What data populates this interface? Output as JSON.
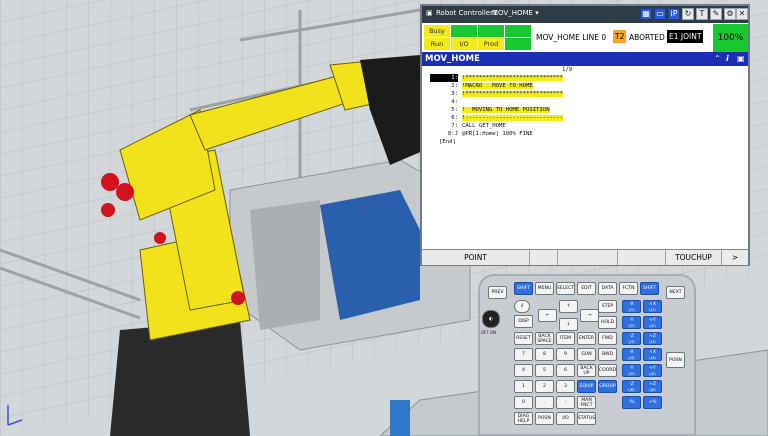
{
  "window": {
    "title": "Robot Controller1",
    "program_dropdown": "MOV_HOME"
  },
  "titlebar_icons": [
    "keyboard-icon",
    "screen-icon",
    "ip-icon",
    "refresh-icon",
    "text-icon",
    "edit-icon",
    "settings-icon",
    "close-icon"
  ],
  "status": {
    "leds": [
      {
        "label": "Busy",
        "color": "#f2ea1a"
      },
      {
        "label": "",
        "color": "#18c82f"
      },
      {
        "label": "",
        "color": "#18c82f"
      },
      {
        "label": "",
        "color": "#18c82f"
      },
      {
        "label": "Run",
        "color": "#f2ea1a"
      },
      {
        "label": "I/O",
        "color": "#f2ea1a"
      },
      {
        "label": "Prod",
        "color": "#f2ea1a"
      },
      {
        "label": "",
        "color": "#18c82f"
      }
    ],
    "line_text": "MOV_HOME LINE 0",
    "t2": "T2",
    "state": "ABORTED",
    "joint": "E1 JOINT",
    "override": "100%"
  },
  "program": {
    "name": "MOV_HOME",
    "position": "1/9",
    "lines": [
      {
        "no": "1:",
        "text": "!*****************************",
        "highlight": true,
        "cursor": true
      },
      {
        "no": "2:",
        "text": "!MACRO   MOVE TO HOME",
        "highlight": true,
        "cursor": false
      },
      {
        "no": "3:",
        "text": "!*****************************",
        "highlight": true,
        "cursor": false
      },
      {
        "no": "4:",
        "text": "",
        "highlight": false,
        "cursor": false
      },
      {
        "no": "5:",
        "text": "!  MOVING TO HOME POSITION",
        "highlight": true,
        "cursor": false
      },
      {
        "no": "6:",
        "text": "!-----------------------------",
        "highlight": true,
        "cursor": false
      },
      {
        "no": "7:",
        "text": "CALL GET_HOME",
        "highlight": false,
        "cursor": false
      },
      {
        "no": "8:J",
        "text": "@PR[1:Home] 100% FINE",
        "highlight": false,
        "cursor": false
      }
    ],
    "end_marker": "[End]"
  },
  "softkeys": [
    "POINT",
    "",
    "",
    "",
    "TOUCHUP",
    ">"
  ],
  "keypad": {
    "row1": [
      "PREV",
      "SHIFT",
      "MENU",
      "SELECT",
      "EDIT",
      "DATA",
      "FCTN",
      "SHIFT",
      "NEXT"
    ],
    "info": "i",
    "disp": "DISP",
    "up": "↑",
    "step": "STEP",
    "left": "←",
    "right": "→",
    "hold": "HOLD",
    "down": "↓",
    "fwd": "FWD",
    "reset": "RESET",
    "backspace": "BACK SPACE",
    "item": "ITEM",
    "enter": "ENTER",
    "bwd": "BWD",
    "gun": "GUN",
    "coord": "COORD",
    "backup": "BACK UP",
    "equip": "EQUIP",
    "group": "GROUP",
    "posn_side": "POSN",
    "off_on": "OFF ON",
    "digits": [
      "7",
      "8",
      "9",
      "4",
      "5",
      "6",
      "1",
      "2",
      "3",
      "0",
      ".",
      "-"
    ],
    "man_fnct": "MAN FNCT",
    "diag_help": "DIAG HELP",
    "posn": "POSN",
    "io": "I/O",
    "status": "STATUS",
    "jog": [
      [
        "-X",
        "+X"
      ],
      [
        "-Y",
        "+Y"
      ],
      [
        "-Z",
        "+Z"
      ],
      [
        "-X",
        "+X"
      ],
      [
        "-Y",
        "+Y"
      ],
      [
        "-Z",
        "+Z"
      ],
      [
        "-%",
        "+%"
      ]
    ],
    "jog_sub": [
      [
        "(J1)",
        "(J1)"
      ],
      [
        "(J2)",
        "(J2)"
      ],
      [
        "(J3)",
        "(J3)"
      ],
      [
        "(J4)",
        "(J4)"
      ],
      [
        "(J5)",
        "(J5)"
      ],
      [
        "(J6)",
        "(J6)"
      ],
      [
        "",
        ""
      ]
    ]
  }
}
